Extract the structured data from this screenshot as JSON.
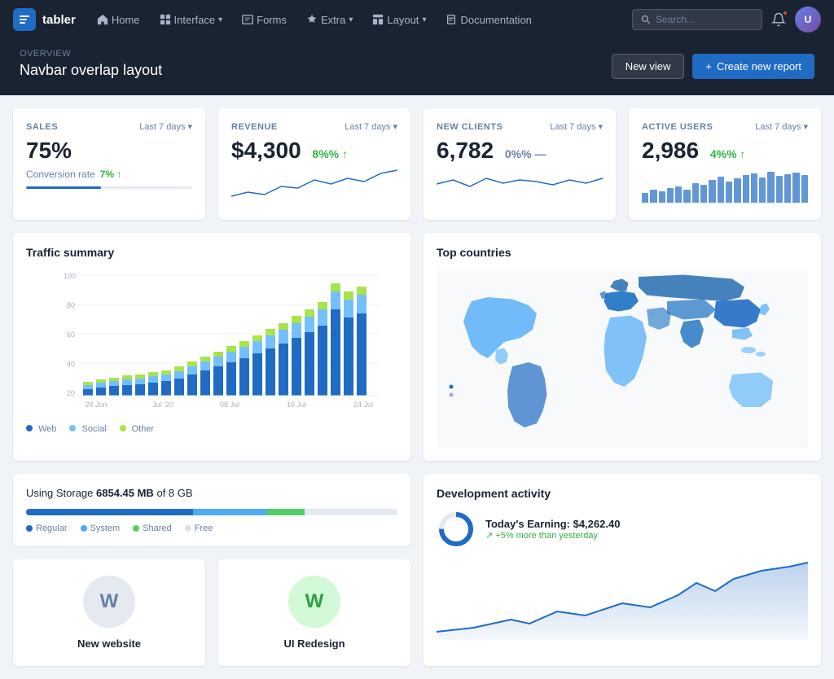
{
  "app": {
    "brand": "tabler",
    "brand_logo": "t"
  },
  "navbar": {
    "items": [
      {
        "label": "Home",
        "icon": "home",
        "has_dropdown": false
      },
      {
        "label": "Interface",
        "icon": "layout",
        "has_dropdown": true
      },
      {
        "label": "Forms",
        "icon": "check-square",
        "has_dropdown": false
      },
      {
        "label": "Extra",
        "icon": "star",
        "has_dropdown": true
      },
      {
        "label": "Layout",
        "icon": "grid",
        "has_dropdown": true
      },
      {
        "label": "Documentation",
        "icon": "file-text",
        "has_dropdown": false
      }
    ],
    "search_placeholder": "Search...",
    "avatar_initials": "U"
  },
  "subheader": {
    "overview": "OVERVIEW",
    "title": "Navbar overlap layout",
    "btn_new_view": "New view",
    "btn_create_report": "Create new report"
  },
  "stats": [
    {
      "label": "SALES",
      "period": "Last 7 days",
      "value": "75%",
      "sub_label": "Conversion rate",
      "sub_value": "7%",
      "trend": "up",
      "bar_width": "45"
    },
    {
      "label": "REVENUE",
      "period": "Last 7 days",
      "value": "$4,300",
      "sub_value": "8%",
      "trend": "up"
    },
    {
      "label": "NEW CLIENTS",
      "period": "Last 7 days",
      "value": "6,782",
      "sub_value": "0%",
      "trend": "neutral"
    },
    {
      "label": "ACTIVE USERS",
      "period": "Last 7 days",
      "value": "2,986",
      "sub_value": "4%",
      "trend": "up"
    }
  ],
  "traffic_summary": {
    "title": "Traffic summary",
    "legend": [
      {
        "label": "Web",
        "color": "#206bc4"
      },
      {
        "label": "Social",
        "color": "#74c0fc"
      },
      {
        "label": "Other",
        "color": "#a9e34b"
      }
    ],
    "x_labels": [
      "24 Jun",
      "Jul '20",
      "08 Jul",
      "16 Jul",
      "24 Jul"
    ]
  },
  "top_countries": {
    "title": "Top countries"
  },
  "storage": {
    "label": "Using Storage",
    "used": "6854.45 MB",
    "total": "8 GB",
    "segments": [
      {
        "label": "Regular",
        "color": "#206bc4",
        "width": "45"
      },
      {
        "label": "System",
        "color": "#4dabf7",
        "width": "20"
      },
      {
        "label": "Shared",
        "color": "#51cf66",
        "width": "10"
      },
      {
        "label": "Free",
        "color": "#e5e9f0",
        "width": "25"
      }
    ]
  },
  "projects": [
    {
      "name": "New website",
      "initial": "W",
      "style": "gray"
    },
    {
      "name": "UI Redesign",
      "initial": "W",
      "style": "green"
    }
  ],
  "dev_activity": {
    "title": "Development activity",
    "earning_label": "Today's Earning: $4,262.40",
    "earning_sub": "+5% more than yesterday"
  }
}
